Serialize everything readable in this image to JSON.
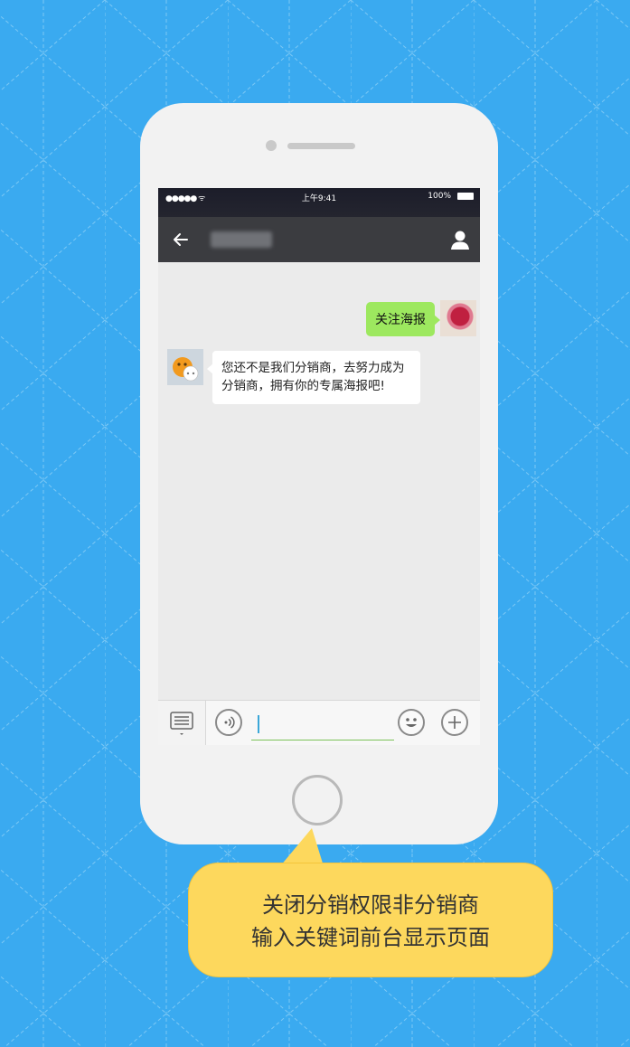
{
  "status_bar": {
    "signal": "●●●●● ᯤ",
    "time": "上午9:41",
    "battery": "100%"
  },
  "nav": {
    "back_icon": "back-arrow-icon",
    "title": "",
    "profile_icon": "profile-icon"
  },
  "messages": [
    {
      "side": "right",
      "text": "关注海报"
    },
    {
      "side": "left",
      "text": "您还不是我们分销商，去努力成为分销商，拥有你的专属海报吧!"
    }
  ],
  "input_bar": {
    "menu_icon": "list-menu-icon",
    "voice_icon": "voice-icon",
    "emoji_icon": "emoji-icon",
    "plus_icon": "plus-icon",
    "value": ""
  },
  "callout": {
    "line1": "关闭分销权限非分销商",
    "line2": "输入关键词前台显示页面"
  },
  "colors": {
    "background": "#3aaaf0",
    "green_bubble": "#9de85f",
    "callout": "#fdd85d"
  }
}
